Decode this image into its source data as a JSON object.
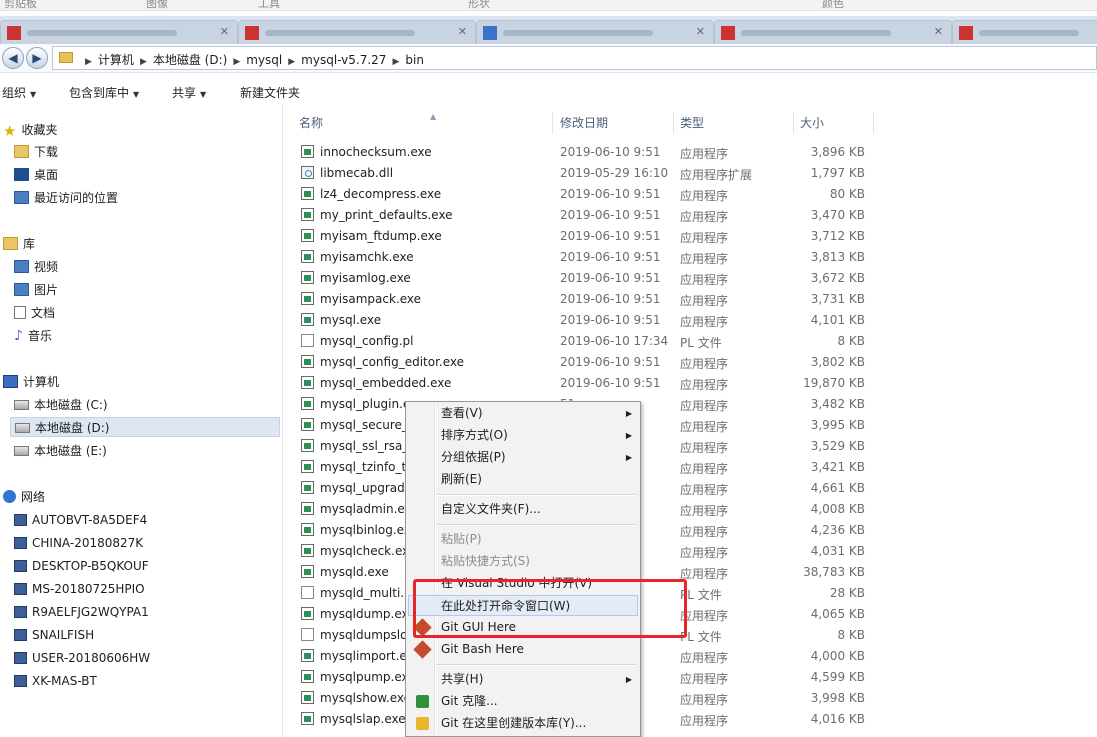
{
  "ribbon": {
    "groups": [
      "剪贴板",
      "图像",
      "工具",
      "形状",
      "颜色"
    ]
  },
  "address_bar": {
    "back_symbol": "◀",
    "forward_symbol": "▶",
    "crumbs": [
      "计算机",
      "本地磁盘 (D:)",
      "mysql",
      "mysql-v5.7.27",
      "bin"
    ],
    "separator": "▶"
  },
  "toolbar": {
    "organize": "组织",
    "include_in_library": "包含到库中",
    "share": "共享",
    "new_folder": "新建文件夹",
    "arrow": "▼"
  },
  "nav": {
    "favorites": "收藏夹",
    "downloads": "下载",
    "desktop": "桌面",
    "recent": "最近访问的位置",
    "libraries": "库",
    "videos": "视频",
    "pictures": "图片",
    "documents": "文档",
    "music": "音乐",
    "computer": "计算机",
    "drive_c": "本地磁盘 (C:)",
    "drive_d": "本地磁盘 (D:)",
    "drive_e": "本地磁盘 (E:)",
    "network": "网络",
    "network_computers": [
      "AUTOBVT-8A5DEF4",
      "CHINA-20180827K",
      "DESKTOP-B5QKOUF",
      "MS-20180725HPIO",
      "R9AELFJG2WQYPA1",
      "SNAILFISH",
      "USER-20180606HW",
      "XK-MAS-BT"
    ]
  },
  "columns": {
    "name": "名称",
    "date": "修改日期",
    "type": "类型",
    "size": "大小"
  },
  "files": [
    {
      "name": "innochecksum.exe",
      "date": "2019-06-10 9:51",
      "type": "应用程序",
      "size": "3,896 KB",
      "icon": "exe"
    },
    {
      "name": "libmecab.dll",
      "date": "2019-05-29 16:10",
      "type": "应用程序扩展",
      "size": "1,797 KB",
      "icon": "dll"
    },
    {
      "name": "lz4_decompress.exe",
      "date": "2019-06-10 9:51",
      "type": "应用程序",
      "size": "80 KB",
      "icon": "exe"
    },
    {
      "name": "my_print_defaults.exe",
      "date": "2019-06-10 9:51",
      "type": "应用程序",
      "size": "3,470 KB",
      "icon": "exe"
    },
    {
      "name": "myisam_ftdump.exe",
      "date": "2019-06-10 9:51",
      "type": "应用程序",
      "size": "3,712 KB",
      "icon": "exe"
    },
    {
      "name": "myisamchk.exe",
      "date": "2019-06-10 9:51",
      "type": "应用程序",
      "size": "3,813 KB",
      "icon": "exe"
    },
    {
      "name": "myisamlog.exe",
      "date": "2019-06-10 9:51",
      "type": "应用程序",
      "size": "3,672 KB",
      "icon": "exe"
    },
    {
      "name": "myisampack.exe",
      "date": "2019-06-10 9:51",
      "type": "应用程序",
      "size": "3,731 KB",
      "icon": "exe"
    },
    {
      "name": "mysql.exe",
      "date": "2019-06-10 9:51",
      "type": "应用程序",
      "size": "4,101 KB",
      "icon": "exe"
    },
    {
      "name": "mysql_config.pl",
      "date": "2019-06-10 17:34",
      "type": "PL 文件",
      "size": "8 KB",
      "icon": "pl"
    },
    {
      "name": "mysql_config_editor.exe",
      "date": "2019-06-10 9:51",
      "type": "应用程序",
      "size": "3,802 KB",
      "icon": "exe"
    },
    {
      "name": "mysql_embedded.exe",
      "date": "2019-06-10 9:51",
      "type": "应用程序",
      "size": "19,870 KB",
      "icon": "exe"
    },
    {
      "name": "mysql_plugin.e",
      "date": "51",
      "type": "应用程序",
      "size": "3,482 KB",
      "icon": "exe"
    },
    {
      "name": "mysql_secure_i",
      "date": "51",
      "type": "应用程序",
      "size": "3,995 KB",
      "icon": "exe"
    },
    {
      "name": "mysql_ssl_rsa_s",
      "date": "51",
      "type": "应用程序",
      "size": "3,529 KB",
      "icon": "exe"
    },
    {
      "name": "mysql_tzinfo_tc",
      "date": "51",
      "type": "应用程序",
      "size": "3,421 KB",
      "icon": "exe"
    },
    {
      "name": "mysql_upgrade",
      "date": "51",
      "type": "应用程序",
      "size": "4,661 KB",
      "icon": "exe"
    },
    {
      "name": "mysqladmin.exe",
      "date": "51",
      "type": "应用程序",
      "size": "4,008 KB",
      "icon": "exe"
    },
    {
      "name": "mysqlbinlog.exe",
      "date": "51",
      "type": "应用程序",
      "size": "4,236 KB",
      "icon": "exe"
    },
    {
      "name": "mysqlcheck.exe",
      "date": "51",
      "type": "应用程序",
      "size": "4,031 KB",
      "icon": "exe"
    },
    {
      "name": "mysqld.exe",
      "date": "48",
      "type": "应用程序",
      "size": "38,783 KB",
      "icon": "exe"
    },
    {
      "name": "mysqld_multi.p",
      "date": ":34",
      "type": "PL 文件",
      "size": "28 KB",
      "icon": "pl"
    },
    {
      "name": "mysqldump.exe",
      "date": "51",
      "type": "应用程序",
      "size": "4,065 KB",
      "icon": "exe"
    },
    {
      "name": "mysqldumpslo",
      "date": ":34",
      "type": "PL 文件",
      "size": "8 KB",
      "icon": "pl"
    },
    {
      "name": "mysqlimport.exe",
      "date": "51",
      "type": "应用程序",
      "size": "4,000 KB",
      "icon": "exe"
    },
    {
      "name": "mysqlpump.exe",
      "date": "51",
      "type": "应用程序",
      "size": "4,599 KB",
      "icon": "exe"
    },
    {
      "name": "mysqlshow.exe",
      "date": "51",
      "type": "应用程序",
      "size": "3,998 KB",
      "icon": "exe"
    },
    {
      "name": "mysqlslap.exe",
      "date": "51",
      "type": "应用程序",
      "size": "4,016 KB",
      "icon": "exe"
    }
  ],
  "context_menu": {
    "view": "查看(V)",
    "sort": "排序方式(O)",
    "group": "分组依据(P)",
    "refresh": "刷新(E)",
    "customize": "自定义文件夹(F)...",
    "paste": "粘贴(P)",
    "paste_shortcut": "粘贴快捷方式(S)",
    "open_vs": "在 Visual Studio 中打开(V)",
    "open_cmd": "在此处打开命令窗口(W)",
    "git_gui": "Git GUI Here",
    "git_bash": "Git Bash Here",
    "share": "共享(H)",
    "git_clone": "Git 克隆...",
    "git_create": "Git 在这里创建版本库(Y)...",
    "submenu_arrow": "▶"
  },
  "colors": {
    "highlight_box": "#e8262a",
    "menu_hover": "#e4ebf6"
  }
}
